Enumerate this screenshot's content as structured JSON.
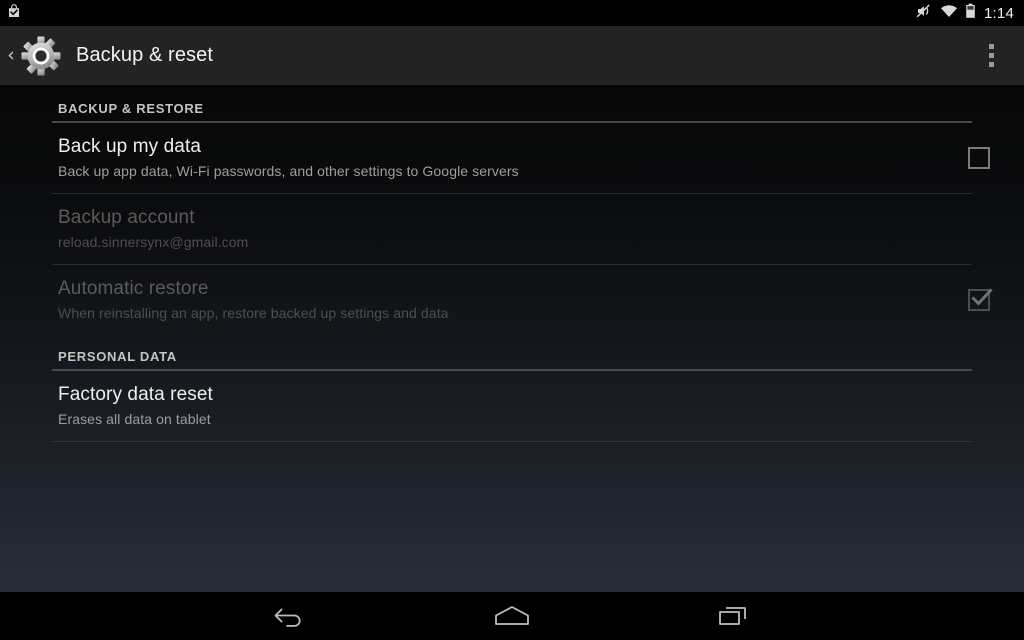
{
  "status_bar": {
    "notification_icon": "play-store-installed-icon",
    "ringer_icon": "volume-muted-icon",
    "wifi_icon": "wifi-icon",
    "battery_icon": "battery-icon",
    "clock": "1:14"
  },
  "action_bar": {
    "back_icon": "back-chevron-icon",
    "app_icon": "settings-gear-icon",
    "title": "Backup & reset",
    "overflow_icon": "overflow-menu-icon"
  },
  "sections": [
    {
      "header": "BACKUP & RESTORE",
      "rows": [
        {
          "title": "Back up my data",
          "summary": "Back up app data, Wi-Fi passwords, and other settings to Google servers",
          "widget": "checkbox",
          "checked": false,
          "enabled": true
        },
        {
          "title": "Backup account",
          "summary": "reload.sinnersynx@gmail.com",
          "widget": "none",
          "enabled": false
        },
        {
          "title": "Automatic restore",
          "summary": "When reinstalling an app, restore backed up settings and data",
          "widget": "checkbox",
          "checked": true,
          "enabled": false
        }
      ]
    },
    {
      "header": "PERSONAL DATA",
      "rows": [
        {
          "title": "Factory data reset",
          "summary": "Erases all data on tablet",
          "widget": "none",
          "enabled": true
        }
      ]
    }
  ],
  "nav_bar": {
    "back_label": "back-icon",
    "home_label": "home-icon",
    "recents_label": "recents-icon"
  },
  "colors": {
    "action_bar_bg": "#232323",
    "title_text": "#efefef",
    "summary_text": "#9e9e9e",
    "disabled_text": "#5b5b5b",
    "section_header_text": "#c4c4c4",
    "nav_icon": "#bdbdbd"
  }
}
